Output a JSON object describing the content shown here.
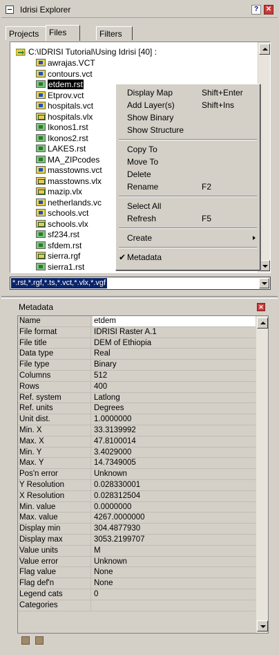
{
  "window": {
    "title": "Idrisi Explorer",
    "help_label": "?",
    "close_label": "✕"
  },
  "tabs": [
    {
      "label": "Projects"
    },
    {
      "label": "Files"
    },
    {
      "label": "Filters"
    }
  ],
  "tree": {
    "root": "C:\\IDRISI Tutorial\\Using Idrisi [40] :",
    "files": [
      {
        "name": "awrajas.VCT",
        "type": "vector"
      },
      {
        "name": "contours.vct",
        "type": "vector"
      },
      {
        "name": "etdem.rst",
        "type": "raster",
        "selected": true
      },
      {
        "name": "Etprov.vct",
        "type": "vector"
      },
      {
        "name": "hospitals.vct",
        "type": "vector"
      },
      {
        "name": "hospitals.vlx",
        "type": "group"
      },
      {
        "name": "Ikonos1.rst",
        "type": "raster"
      },
      {
        "name": "Ikonos2.rst",
        "type": "raster"
      },
      {
        "name": "LAKES.rst",
        "type": "raster"
      },
      {
        "name": "MA_ZIPcodes",
        "type": "raster"
      },
      {
        "name": "masstowns.vct",
        "type": "vector"
      },
      {
        "name": "masstowns.vlx",
        "type": "group"
      },
      {
        "name": "mazip.vlx",
        "type": "group"
      },
      {
        "name": "netherlands.vc",
        "type": "vector"
      },
      {
        "name": "schools.vct",
        "type": "vector"
      },
      {
        "name": "schools.vlx",
        "type": "group"
      },
      {
        "name": "sf234.rst",
        "type": "raster"
      },
      {
        "name": "sfdem.rst",
        "type": "raster"
      },
      {
        "name": "sierra.rgf",
        "type": "group"
      },
      {
        "name": "sierra1.rst",
        "type": "raster"
      }
    ],
    "filter": "*.rst,*.rgf,*.ts,*.vct,*.vlx,*.vgf"
  },
  "context_menu": {
    "groups": [
      [
        {
          "label": "Display Map",
          "shortcut": "Shift+Enter"
        },
        {
          "label": "Add Layer(s)",
          "shortcut": "Shift+Ins"
        },
        {
          "label": "Show Binary",
          "shortcut": ""
        },
        {
          "label": "Show Structure",
          "shortcut": ""
        }
      ],
      [
        {
          "label": "Copy To",
          "shortcut": ""
        },
        {
          "label": "Move To",
          "shortcut": ""
        },
        {
          "label": "Delete",
          "shortcut": ""
        },
        {
          "label": "Rename",
          "shortcut": "F2"
        }
      ],
      [
        {
          "label": "Select All",
          "shortcut": ""
        },
        {
          "label": "Refresh",
          "shortcut": "F5"
        }
      ],
      [
        {
          "label": "Create",
          "shortcut": "",
          "submenu": true
        }
      ],
      [
        {
          "label": "Metadata",
          "shortcut": "",
          "checked": true
        }
      ]
    ],
    "check_glyph": "✔"
  },
  "metadata": {
    "title": "Metadata",
    "close_label": "✕",
    "rows": [
      {
        "key": "Name",
        "value": "etdem"
      },
      {
        "key": "File format",
        "value": "IDRISI Raster A.1"
      },
      {
        "key": "File title",
        "value": "DEM of Ethiopia"
      },
      {
        "key": "Data type",
        "value": "Real"
      },
      {
        "key": "File type",
        "value": "Binary"
      },
      {
        "key": "Columns",
        "value": "512"
      },
      {
        "key": "Rows",
        "value": "400"
      },
      {
        "key": "Ref. system",
        "value": "Latlong"
      },
      {
        "key": "Ref. units",
        "value": "Degrees"
      },
      {
        "key": "Unit dist.",
        "value": "1.0000000"
      },
      {
        "key": "Min. X",
        "value": "33.3139992"
      },
      {
        "key": "Max. X",
        "value": "47.8100014"
      },
      {
        "key": "Min. Y",
        "value": "3.4029000"
      },
      {
        "key": "Max. Y",
        "value": "14.7349005"
      },
      {
        "key": "Pos'n error",
        "value": "Unknown"
      },
      {
        "key": "Y Resolution",
        "value": "0.028330001"
      },
      {
        "key": "X Resolution",
        "value": "0.028312504"
      },
      {
        "key": "Min. value",
        "value": "0.0000000"
      },
      {
        "key": "Max. value",
        "value": "4267.0000000"
      },
      {
        "key": "Display min",
        "value": "304.4877930"
      },
      {
        "key": "Display max",
        "value": "3053.2199707"
      },
      {
        "key": "Value units",
        "value": "M"
      },
      {
        "key": "Value error",
        "value": "Unknown"
      },
      {
        "key": "Flag value",
        "value": "None"
      },
      {
        "key": "Flag def'n",
        "value": "None"
      },
      {
        "key": "Legend cats",
        "value": "0"
      },
      {
        "key": "Categories",
        "value": ""
      }
    ]
  }
}
